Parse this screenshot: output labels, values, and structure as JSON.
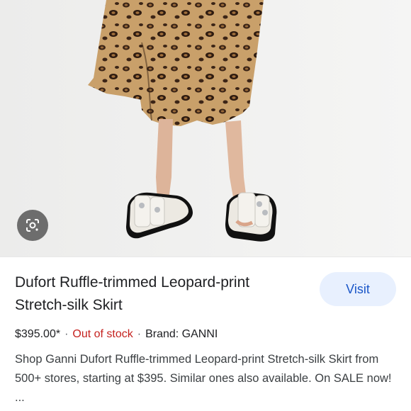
{
  "product": {
    "title": "Dufort Ruffle-trimmed Leopard-print Stretch-silk Skirt",
    "visit_label": "Visit",
    "price": "$395.00*",
    "separator": "·",
    "stock_status": "Out of stock",
    "brand": "Brand: GANNI",
    "description": "Shop Ganni Dufort Ruffle-trimmed Leopard-print Stretch-silk Skirt from 500+ stores, starting at $395. Similar ones also available. On SALE now! ..."
  },
  "icons": {
    "lens": "lens-search-icon"
  },
  "colors": {
    "title": "#202124",
    "stock_status": "#c5221f",
    "visit_button_bg": "#e8f0fe",
    "visit_button_text": "#1a56c8"
  }
}
